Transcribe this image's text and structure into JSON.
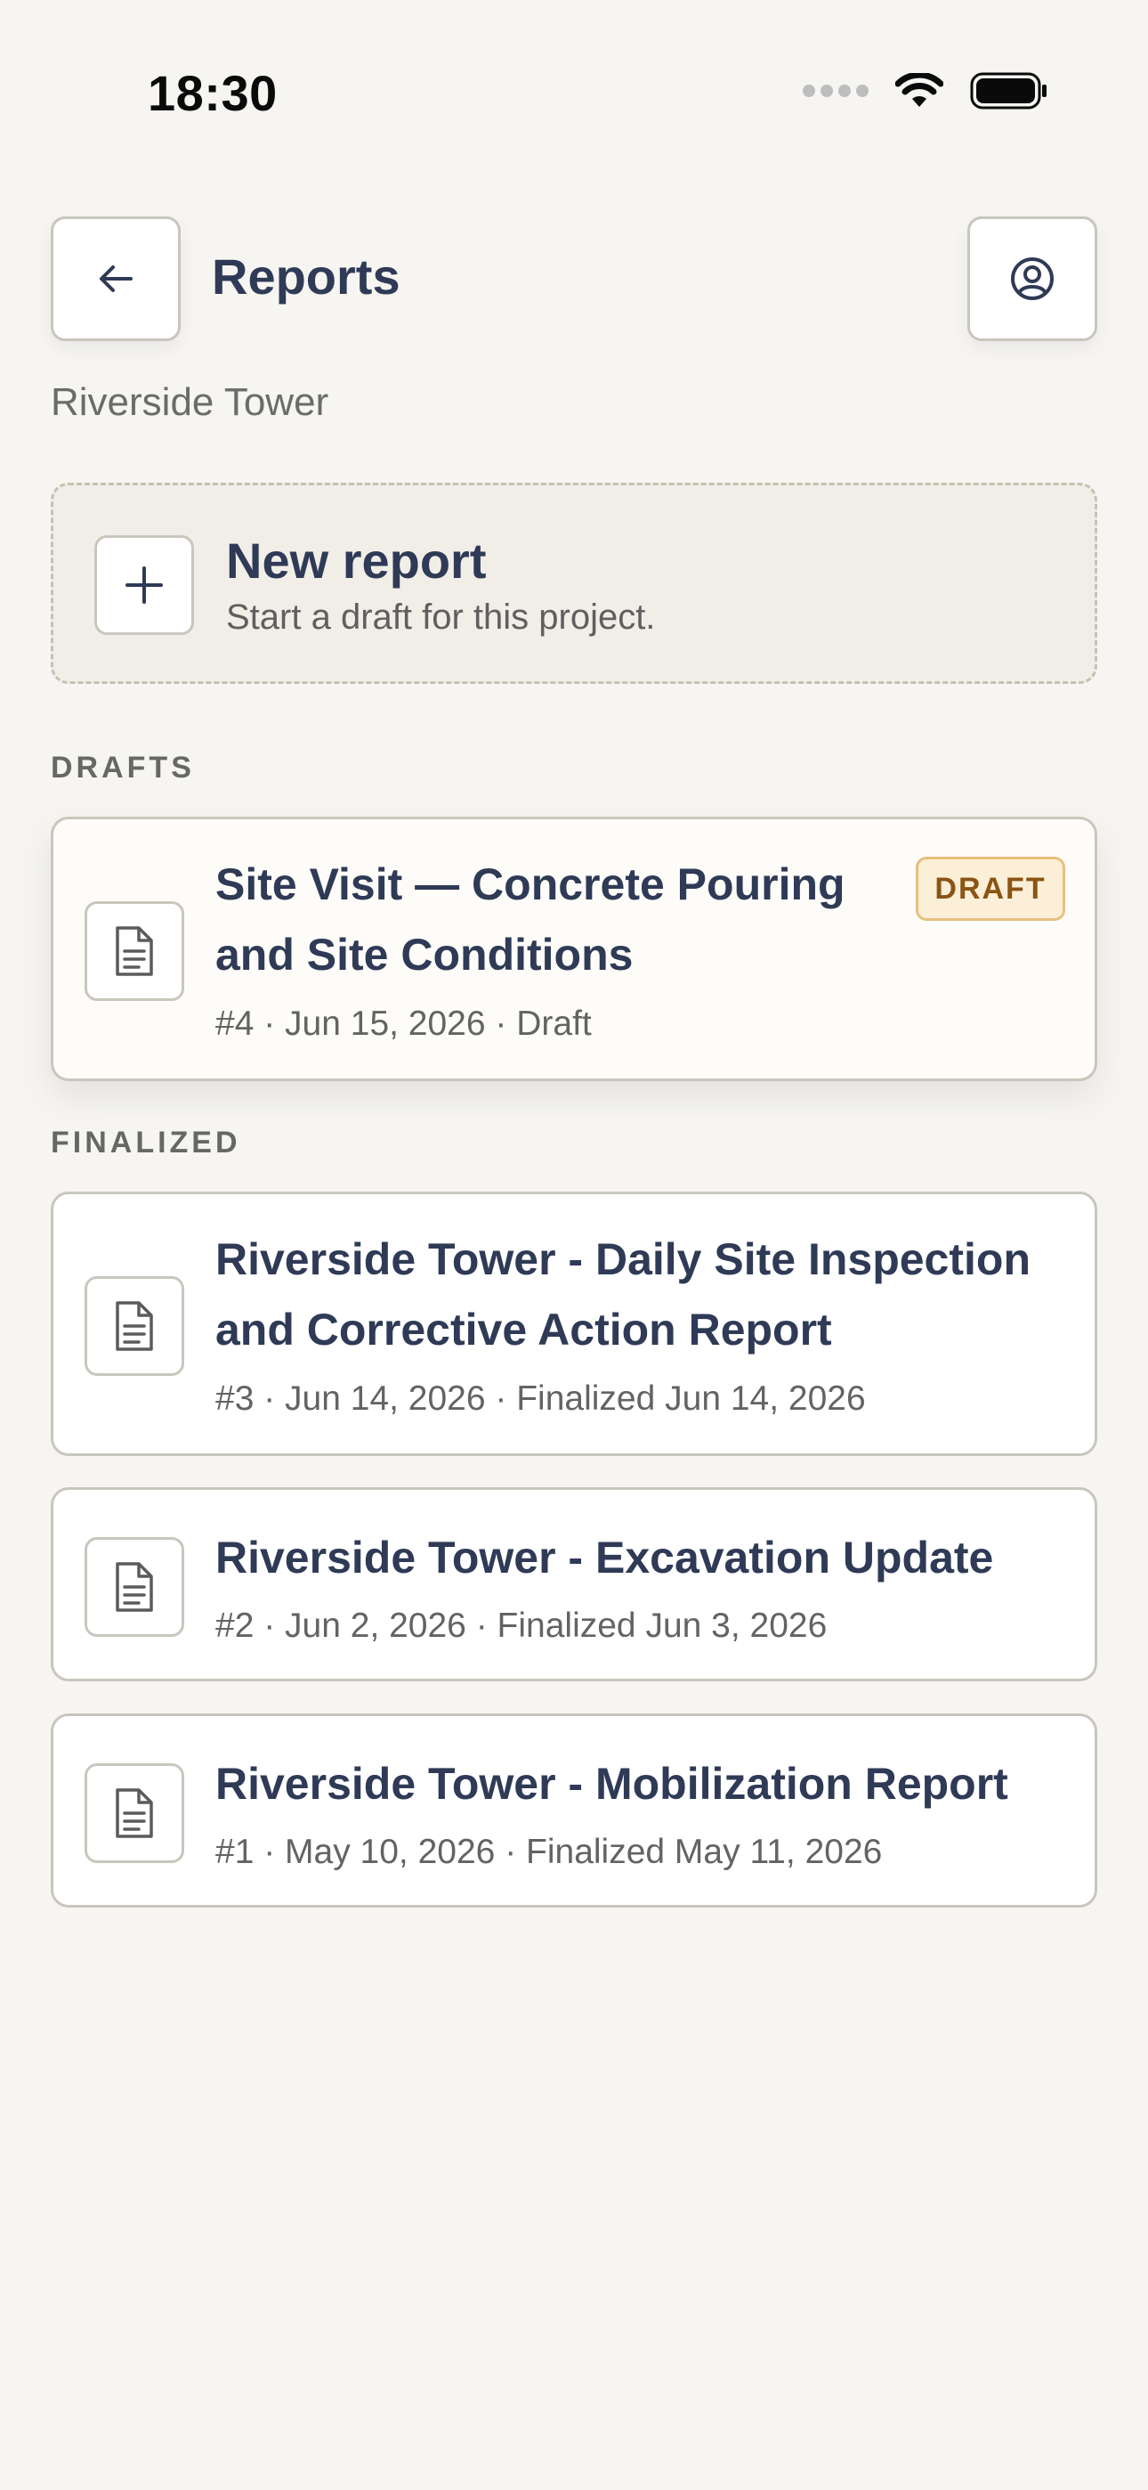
{
  "status_bar": {
    "time": "18:30"
  },
  "header": {
    "title": "Reports",
    "subtitle": "Riverside Tower"
  },
  "new_report": {
    "title": "New report",
    "subtitle": "Start a draft for this project."
  },
  "sections": {
    "drafts_label": "DRAFTS",
    "finalized_label": "FINALIZED"
  },
  "drafts": [
    {
      "title": "Site Visit — Concrete Pouring and Site Conditions",
      "title_line1": "Site Visit — Concrete Pouring",
      "title_line2": "and Site Conditions",
      "meta": "#4 · Jun 15, 2026 · Draft",
      "badge": "DRAFT"
    }
  ],
  "finalized": [
    {
      "title_line1": "Riverside Tower - Daily Site Inspection",
      "title_line2": "and Corrective Action Report",
      "meta": "#3 · Jun 14, 2026 · Finalized Jun 14, 2026"
    },
    {
      "title": "Riverside Tower - Excavation Update",
      "meta": "#2 · Jun 2, 2026 · Finalized Jun 3, 2026"
    },
    {
      "title": "Riverside Tower - Mobilization Report",
      "meta": "#1 · May 10, 2026 · Finalized May 11, 2026"
    }
  ],
  "icons": {
    "back": "arrow-left-icon",
    "account": "user-circle-icon",
    "add": "plus-icon",
    "report": "document-icon",
    "wifi": "wifi-icon",
    "battery": "battery-icon",
    "signal": "signal-icon"
  },
  "colors": {
    "background": "#f6f5f1",
    "text_primary": "#2f3a56",
    "badge_bg": "#fcefd8",
    "badge_border": "#e6c07d",
    "badge_text": "#8a5413"
  }
}
